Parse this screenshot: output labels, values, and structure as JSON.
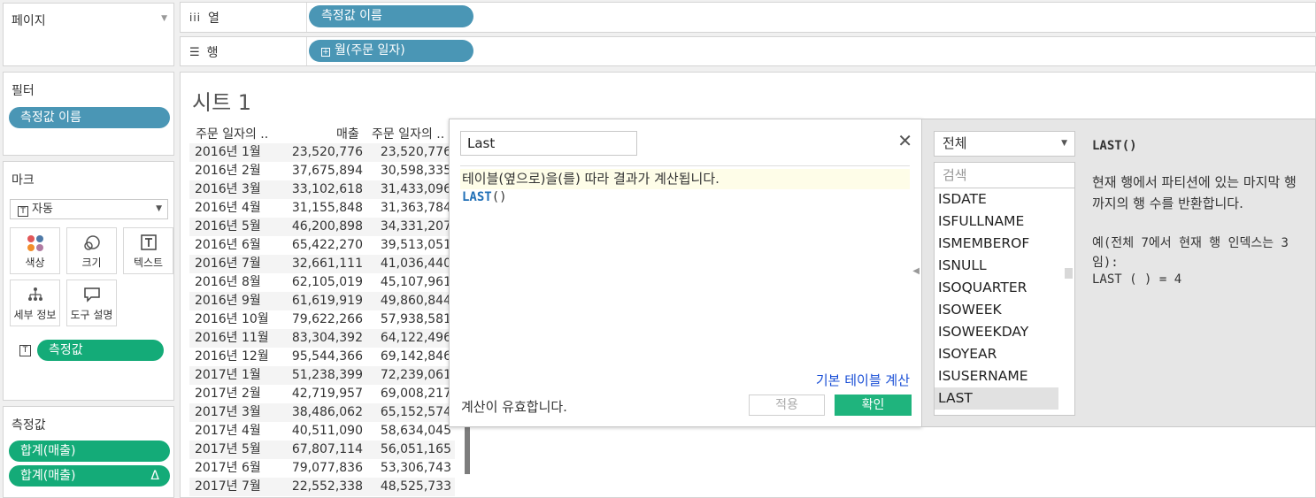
{
  "left": {
    "pages_title": "페이지",
    "filters_title": "필터",
    "filter_pill": "측정값 이름",
    "marks_title": "마크",
    "marks_type": "자동",
    "mark_buttons": {
      "color": "색상",
      "size": "크기",
      "text": "텍스트",
      "detail": "세부 정보",
      "tooltip": "도구 설명"
    },
    "marks_pill": "측정값",
    "measures_title": "측정값",
    "measure_pills": [
      "합계(매출)",
      "합계(매출)"
    ],
    "delta_symbol": "Δ"
  },
  "shelves": {
    "columns_label": "열",
    "columns_pill": "측정값 이름",
    "rows_label": "행",
    "rows_pill": "월(주문 일자)"
  },
  "sheet": {
    "title": "시트 1",
    "headers": [
      "주문 일자의 ..",
      "매출",
      "주문 일자의 .."
    ],
    "rows": [
      [
        "2016년 1월",
        "23,520,776",
        "23,520,776"
      ],
      [
        "2016년 2월",
        "37,675,894",
        "30,598,335"
      ],
      [
        "2016년 3월",
        "33,102,618",
        "31,433,096"
      ],
      [
        "2016년 4월",
        "31,155,848",
        "31,363,784"
      ],
      [
        "2016년 5월",
        "46,200,898",
        "34,331,207"
      ],
      [
        "2016년 6월",
        "65,422,270",
        "39,513,051"
      ],
      [
        "2016년 7월",
        "32,661,111",
        "41,036,440"
      ],
      [
        "2016년 8월",
        "62,105,019",
        "45,107,961"
      ],
      [
        "2016년 9월",
        "61,619,919",
        "49,860,844"
      ],
      [
        "2016년 10월",
        "79,622,266",
        "57,938,581"
      ],
      [
        "2016년 11월",
        "83,304,392",
        "64,122,496"
      ],
      [
        "2016년 12월",
        "95,544,366",
        "69,142,846"
      ],
      [
        "2017년 1월",
        "51,238,399",
        "72,239,061"
      ],
      [
        "2017년 2월",
        "42,719,957",
        "69,008,217"
      ],
      [
        "2017년 3월",
        "38,486,062",
        "65,152,574"
      ],
      [
        "2017년 4월",
        "40,511,090",
        "58,634,045"
      ],
      [
        "2017년 5월",
        "67,807,114",
        "56,051,165"
      ],
      [
        "2017년 6월",
        "79,077,836",
        "53,306,743"
      ],
      [
        "2017년 7월",
        "22,552,338",
        "48,525,733"
      ]
    ]
  },
  "calc": {
    "name": "Last",
    "formula_comment": "테이블(옆으로)을(를) 따라 결과가 계산됩니다.",
    "formula_fn": "LAST",
    "formula_parens": "()",
    "base_link": "기본 테이블 계산",
    "valid_msg": "계산이 유효합니다.",
    "apply_label": "적용",
    "ok_label": "확인",
    "category": "전체",
    "search_placeholder": "검색",
    "functions": [
      "ISDATE",
      "ISFULLNAME",
      "ISMEMBEROF",
      "ISNULL",
      "ISOQUARTER",
      "ISOWEEK",
      "ISOWEEKDAY",
      "ISOYEAR",
      "ISUSERNAME",
      "LAST"
    ],
    "help_title": "LAST()",
    "help_desc": "현재 행에서 파티션에 있는 마지막 행까지의 행 수를 반환합니다.",
    "help_example": "예(전체 7에서 현재 행 인덱스는 3임):",
    "help_example_code": "LAST ( ) = 4"
  }
}
